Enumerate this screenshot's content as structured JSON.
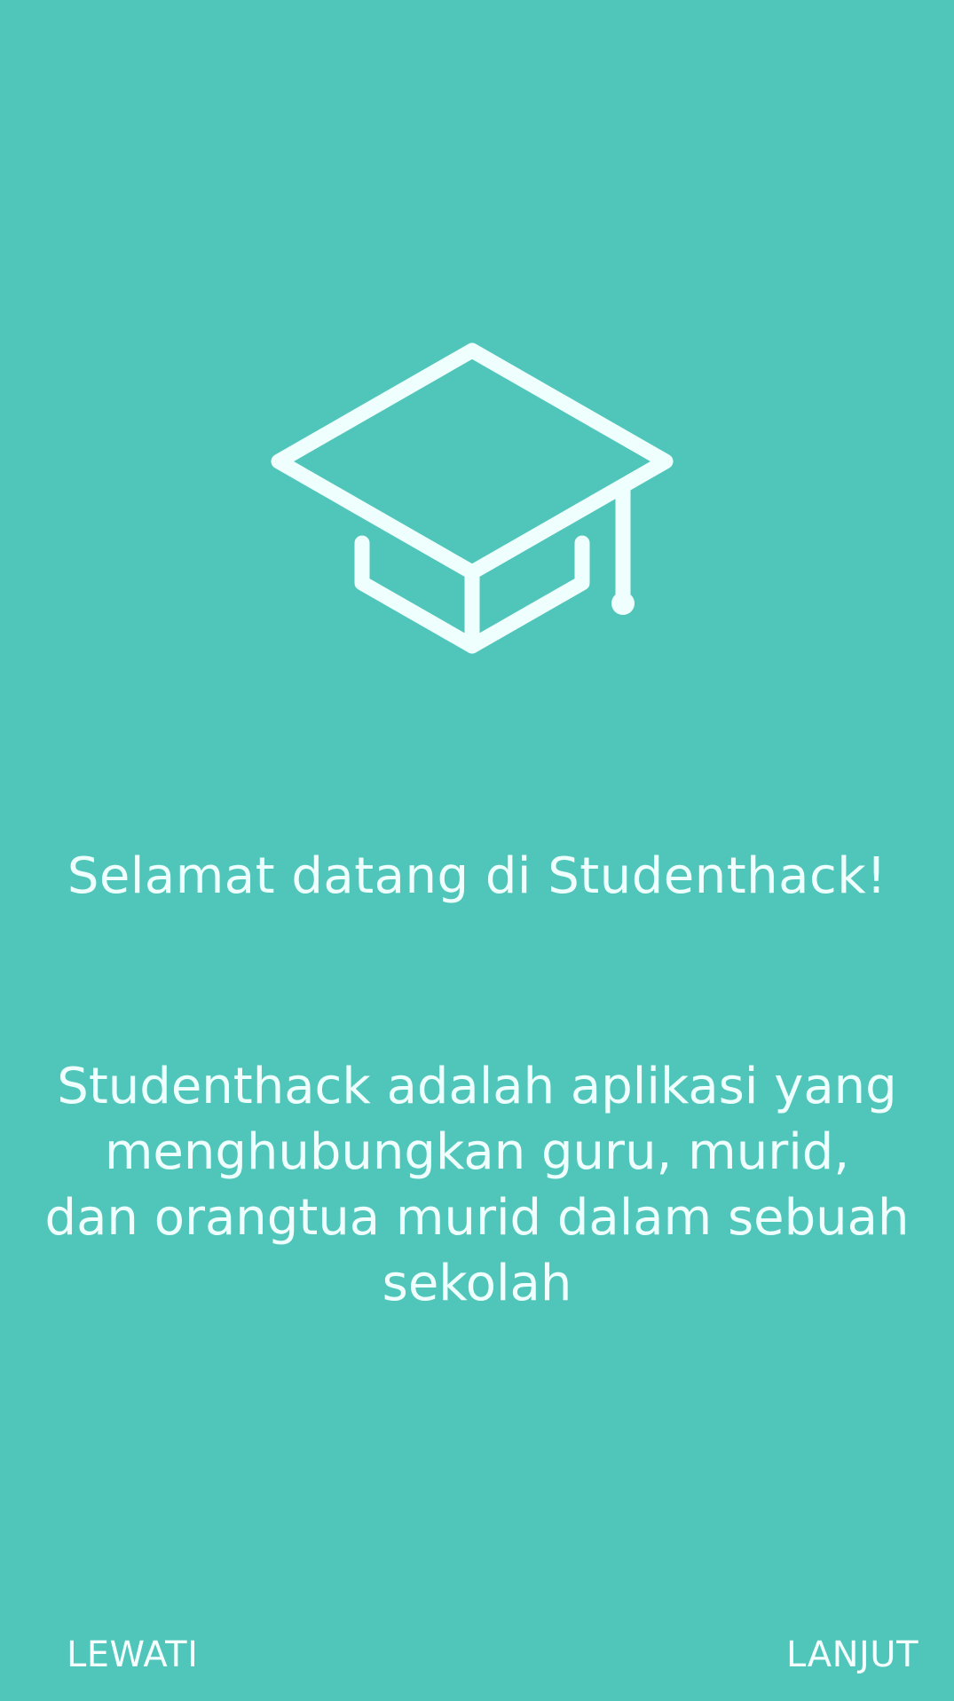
{
  "theme": {
    "background": "#50C6BB",
    "icon_color": "#EFFFFD",
    "text_color": "#EFFFFD"
  },
  "hero": {
    "icon": "graduation-cap-icon"
  },
  "welcome": {
    "title": "Selamat datang di Studenthack!",
    "description_lines": [
      "Studenthack adalah aplikasi yang",
      "menghubungkan guru, murid,",
      "dan orangtua murid dalam sebuah",
      "sekolah"
    ]
  },
  "footer": {
    "skip_label": "LEWATI",
    "next_label": "LANJUT"
  }
}
